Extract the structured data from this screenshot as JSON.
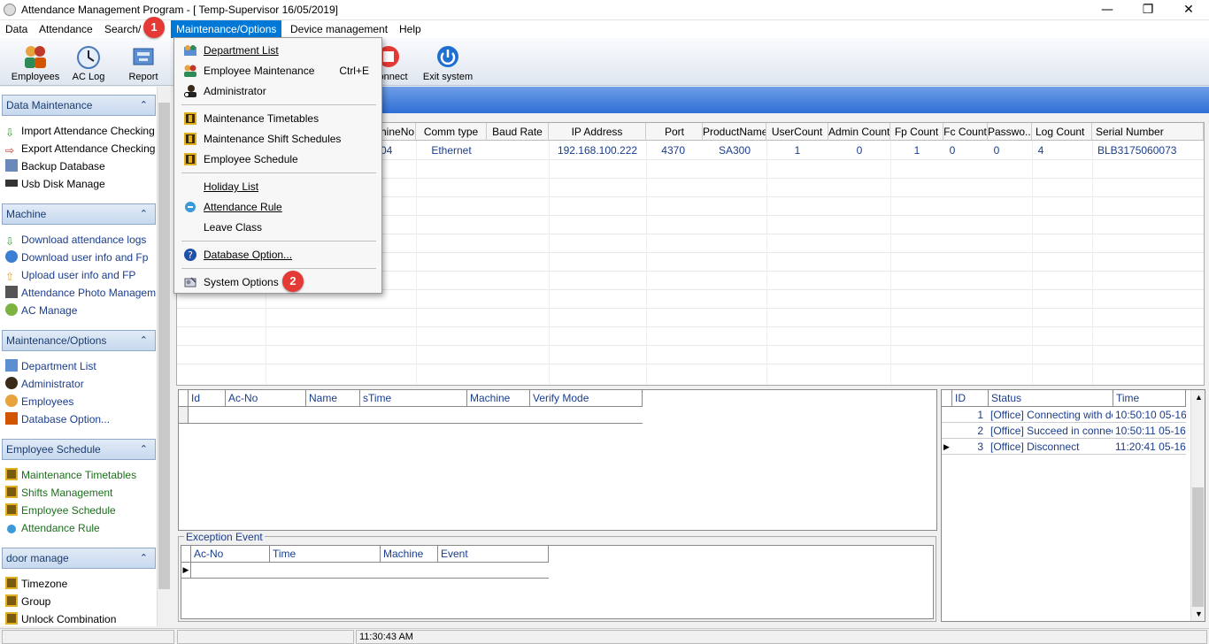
{
  "window": {
    "title": "Attendance Management Program - [ Temp-Supervisor 16/05/2019]",
    "min": "—",
    "max": "❐",
    "close": "✕"
  },
  "menu": [
    "Data",
    "Attendance",
    "Search/Print",
    "Maintenance/Options",
    "Device management",
    "Help"
  ],
  "markers": [
    "1",
    "2"
  ],
  "toolbar": [
    {
      "label": "Employees",
      "icon": "employees-icon"
    },
    {
      "label": "AC Log",
      "icon": "clock-icon"
    },
    {
      "label": "Report",
      "icon": "report-icon"
    },
    {
      "label": "Disconnect",
      "visible_label": "onnect",
      "icon": "disconnect-icon"
    },
    {
      "label": "Exit system",
      "icon": "power-icon"
    }
  ],
  "sidebar": {
    "groups": [
      {
        "title": "Data Maintenance",
        "items": [
          "Import Attendance Checking ...",
          "Export Attendance Checking ...",
          "Backup Database",
          "Usb Disk Manage"
        ]
      },
      {
        "title": "Machine",
        "items": [
          "Download attendance logs",
          "Download user info and Fp",
          "Upload user info and FP",
          "Attendance Photo Managem...",
          "AC Manage"
        ]
      },
      {
        "title": "Maintenance/Options",
        "items": [
          "Department List",
          "Administrator",
          "Employees",
          "Database Option..."
        ]
      },
      {
        "title": "Employee Schedule",
        "items": [
          "Maintenance Timetables",
          "Shifts Management",
          "Employee Schedule",
          "Attendance Rule"
        ]
      },
      {
        "title": "door manage",
        "items": [
          "Timezone",
          "Group",
          "Unlock Combination"
        ]
      }
    ],
    "chevron": "⌃"
  },
  "device_grid": {
    "headers": [
      "",
      "",
      "hineNo.",
      "Comm type",
      "Baud Rate",
      "IP Address",
      "Port",
      "ProductName",
      "UserCount",
      "Admin Count",
      "Fp Count",
      "Fc Count",
      "Passwo...",
      "Log Count",
      "Serial Number"
    ],
    "row": [
      "",
      "",
      "04",
      "Ethernet",
      "",
      "192.168.100.222",
      "4370",
      "SA300",
      "1",
      "0",
      "1",
      "0",
      "0",
      "4",
      "BLB3175060073"
    ]
  },
  "log_grid": {
    "headers": [
      "Id",
      "Ac-No",
      "Name",
      "sTime",
      "Machine",
      "Verify Mode"
    ]
  },
  "exception": {
    "caption": "Exception Event",
    "headers": [
      "Ac-No",
      "Time",
      "Machine",
      "Event"
    ]
  },
  "status_grid": {
    "headers": [
      "ID",
      "Status",
      "Time"
    ],
    "rows": [
      {
        "id": "1",
        "status": "[Office] Connecting with device",
        "time": "10:50:10 05-16"
      },
      {
        "id": "2",
        "status": "[Office] Succeed in connecting",
        "time": "10:50:11 05-16"
      },
      {
        "id": "3",
        "status": "[Office] Disconnect",
        "time": "11:20:41 05-16"
      }
    ]
  },
  "statusbar": {
    "time": "11:30:43 AM"
  },
  "dropdown": [
    {
      "label": "Department List",
      "shortcut": "",
      "icon": "department-icon",
      "underline": true
    },
    {
      "label": "Employee Maintenance",
      "shortcut": "Ctrl+E",
      "icon": "employees-icon",
      "underline": false
    },
    {
      "label": "Administrator",
      "shortcut": "",
      "icon": "administrator-icon",
      "underline": false
    },
    {
      "label": "Maintenance Timetables",
      "shortcut": "",
      "icon": "timetable-icon",
      "underline": false
    },
    {
      "label": "Maintenance Shift Schedules",
      "shortcut": "",
      "icon": "shift-icon",
      "underline": false
    },
    {
      "label": "Employee Schedule",
      "shortcut": "",
      "icon": "schedule-icon",
      "underline": false
    },
    {
      "label": "Holiday List",
      "shortcut": "",
      "icon": "",
      "underline": true
    },
    {
      "label": "Attendance Rule",
      "shortcut": "",
      "icon": "rule-icon",
      "underline": true
    },
    {
      "label": "Leave Class",
      "shortcut": "",
      "icon": "",
      "underline": false
    },
    {
      "label": "Database Option...",
      "shortcut": "",
      "icon": "help-icon",
      "underline": true
    },
    {
      "label": "System Options",
      "shortcut": "",
      "icon": "system-options-icon",
      "underline": false
    }
  ]
}
